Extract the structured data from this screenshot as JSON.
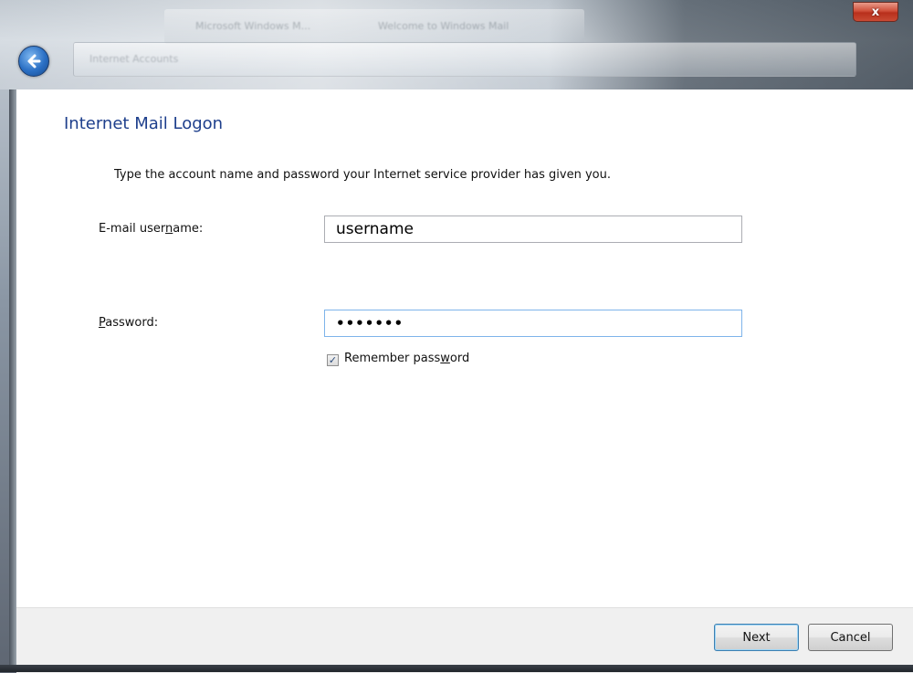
{
  "window": {
    "close_glyph": "x",
    "back_icon": "back-arrow-icon",
    "background_tabs": [
      "Microsoft Windows M...",
      "Welcome to Windows Mail"
    ],
    "background_address": "Internet Accounts"
  },
  "dialog": {
    "title": "Internet Mail Logon",
    "instruction": "Type the account name and password your Internet service provider has given you.",
    "username_label_pre": "E-mail user",
    "username_label_access": "n",
    "username_label_post": "ame:",
    "username_value": "username",
    "password_label_access": "P",
    "password_label_post": "assword:",
    "password_value": "•••••••",
    "remember_label_pre": "Remember pass",
    "remember_label_access": "w",
    "remember_label_post": "ord",
    "remember_checked": true
  },
  "footer": {
    "next_label": "Next",
    "cancel_label": "Cancel"
  },
  "colors": {
    "title": "#1e3f8c",
    "close_button": "#c94a34",
    "back_button": "#2a6fc4"
  }
}
